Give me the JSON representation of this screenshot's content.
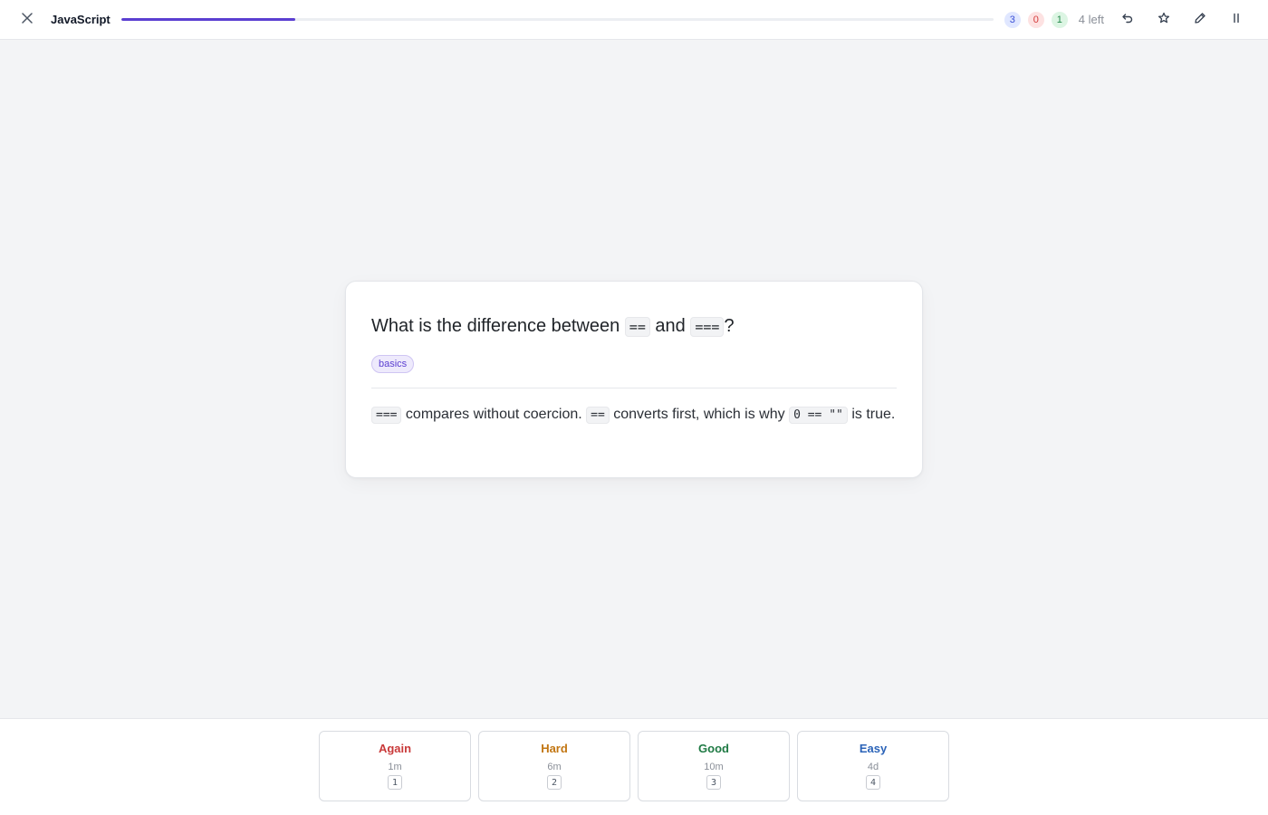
{
  "deck": {
    "title": "JavaScript"
  },
  "progress": {
    "fraction": 0.2
  },
  "counts": {
    "new": "3",
    "lapse": "0",
    "review": "1",
    "left": "4 left"
  },
  "toolbar": {
    "close_icon": "close-icon",
    "undo_icon": "undo-icon",
    "star_icon": "star-icon",
    "edit_icon": "pencil-icon",
    "pause_icon": "pause-icon"
  },
  "card": {
    "question": {
      "pre": "What is the difference between ",
      "code1": "==",
      "mid": " and ",
      "code2": "===",
      "post": "?"
    },
    "tag": "basics",
    "answer": {
      "code1": "===",
      "t1": " compares without coercion. ",
      "code2": "==",
      "t2": " converts first, which is why ",
      "code3": "0 == \"\"",
      "t3": " is true."
    }
  },
  "ratings": [
    {
      "label": "Again",
      "interval": "1m",
      "key": "1",
      "color": "#c93a3a"
    },
    {
      "label": "Hard",
      "interval": "6m",
      "key": "2",
      "color": "#c27612"
    },
    {
      "label": "Good",
      "interval": "10m",
      "key": "3",
      "color": "#1f7a44"
    },
    {
      "label": "Easy",
      "interval": "4d",
      "key": "4",
      "color": "#2b63b8"
    }
  ],
  "colors": {
    "accent": "#5b3fd1"
  }
}
